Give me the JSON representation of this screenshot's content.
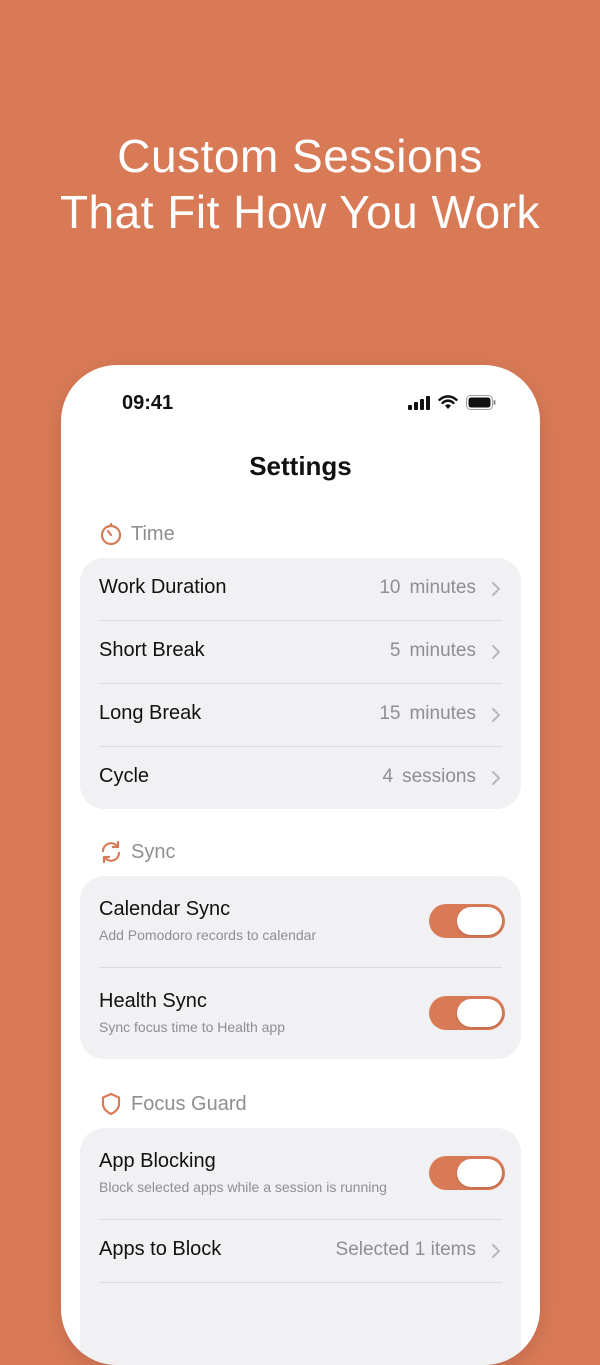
{
  "headline": {
    "line1": "Custom Sessions",
    "line2": "That Fit How You Work"
  },
  "status_bar": {
    "time": "09:41",
    "icons": [
      "cellular-signal-icon",
      "wifi-icon",
      "battery-icon"
    ]
  },
  "page_title": "Settings",
  "colors": {
    "background": "#D97A57",
    "accent": "#D97A57",
    "card": "#F1F1F4",
    "secondary_text": "#8E8E93"
  },
  "sections": {
    "time": {
      "title": "Time",
      "icon": "timer-icon",
      "rows": [
        {
          "label": "Work Duration",
          "value": "10",
          "unit": "minutes"
        },
        {
          "label": "Short Break",
          "value": "5",
          "unit": "minutes"
        },
        {
          "label": "Long Break",
          "value": "15",
          "unit": "minutes"
        },
        {
          "label": "Cycle",
          "value": "4",
          "unit": "sessions"
        }
      ]
    },
    "sync": {
      "title": "Sync",
      "icon": "sync-icon",
      "rows": [
        {
          "label": "Calendar Sync",
          "subtitle": "Add Pomodoro records to calendar",
          "on": true
        },
        {
          "label": "Health Sync",
          "subtitle": "Sync focus time to Health app",
          "on": true
        }
      ]
    },
    "focus_guard": {
      "title": "Focus Guard",
      "icon": "shield-icon",
      "app_blocking": {
        "label": "App Blocking",
        "subtitle": "Block selected apps while a session is running",
        "on": true
      },
      "apps_to_block": {
        "label": "Apps to Block",
        "value": "Selected 1 items"
      }
    }
  }
}
